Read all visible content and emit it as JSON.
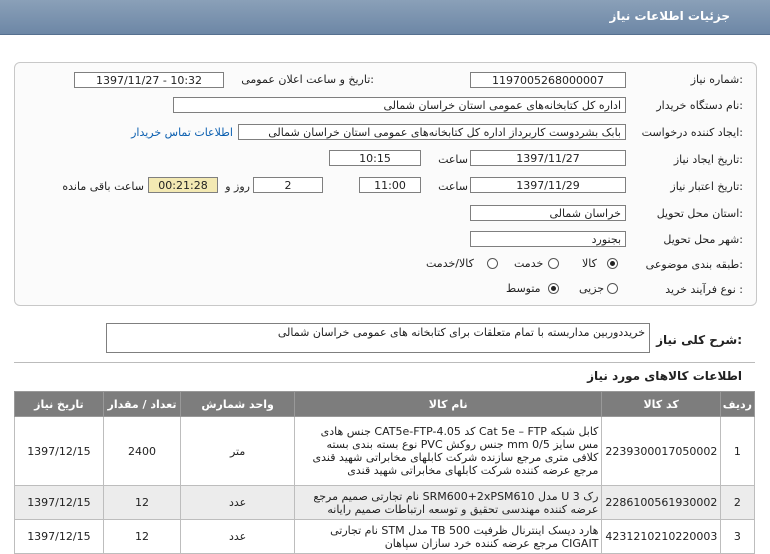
{
  "window": {
    "title": "جزئیات اطلاعات نیاز"
  },
  "form": {
    "need_number": {
      "label": "شماره نیاز:",
      "value": "1197005268000007"
    },
    "announce_datetime": {
      "label": "تاریخ و ساعت اعلان عمومی:",
      "value": "1397/11/27 - 10:32"
    },
    "buyer_org": {
      "label": "نام دستگاه خریدار:",
      "value": "اداره کل کتابخانه‌های عمومی استان خراسان شمالی"
    },
    "requester": {
      "label": "ایجاد کننده درخواست:",
      "value": "بابک  بشردوست کاربرداز  اداره کل کتابخانه‌های عمومی استان خراسان شمالی",
      "contact_link": "اطلاعات تماس خریدار"
    },
    "created": {
      "label": "تاریخ ایجاد نیاز:",
      "date": "1397/11/27",
      "time_label": "ساعت",
      "time": "10:15"
    },
    "validity": {
      "label": "تاریخ اعتبار نیاز:",
      "date": "1397/11/29",
      "time_label": "ساعت",
      "time": "11:00",
      "days": "2",
      "days_label": "روز و",
      "remaining": "00:21:28",
      "remaining_label": "ساعت باقی مانده"
    },
    "delivery_province": {
      "label": "استان محل تحویل:",
      "value": "خراسان شمالی"
    },
    "delivery_city": {
      "label": "شهر محل تحویل:",
      "value": "بجنورد"
    },
    "category": {
      "label": "طبقه بندی موضوعی:",
      "options": [
        "کالا",
        "خدمت",
        "کالا/خدمت"
      ],
      "selected": "کالا"
    },
    "process": {
      "label": "نوع فرآیند خرید :",
      "options": [
        "جزیی",
        "متوسط"
      ],
      "selected": "متوسط"
    }
  },
  "general_description": {
    "label": "شرح کلی نیاز:",
    "value": "خریددوربین مداربسته با تمام متعلقات برای کتابخانه های عمومی خراسان شمالی"
  },
  "items_section": {
    "title": "اطلاعات کالاهای مورد نیاز"
  },
  "items_table": {
    "headers": [
      "ردیف",
      "کد کالا",
      "نام کالا",
      "واحد شمارش",
      "تعداد / مقدار",
      "تاریخ نیاز"
    ],
    "rows": [
      {
        "row": "1",
        "code": "2239300017050002",
        "name": "کابل شبکه Cat 5e – FTP کد CAT5e-FTP-4.05 جنس هادی مس سایز 0/5 mm جنس روکش PVC نوع بسته بندی بسته کلافی متری مرجع سازنده شرکت کابلهای مخابراتی شهید قندی مرجع عرضه کننده شرکت کابلهای مخابراتی شهید قندی",
        "unit": "متر",
        "qty": "2400",
        "date": "1397/12/15"
      },
      {
        "row": "2",
        "code": "2286100561930002",
        "name": "رک 3 U مدل SRM600+2xPSM610 نام تجارتی صمیم مرجع عرضه کننده مهندسی تحقیق و توسعه ارتباطات صمیم رایانه",
        "unit": "عدد",
        "qty": "12",
        "date": "1397/12/15"
      },
      {
        "row": "3",
        "code": "4231210210220003",
        "name": "هارد دیسک اینترنال ظرفیت TB 500 مدل STM نام تجارتی CIGAIT مرجع عرضه کننده خرد سازان سپاهان",
        "unit": "عدد",
        "qty": "12",
        "date": "1397/12/15"
      }
    ]
  }
}
